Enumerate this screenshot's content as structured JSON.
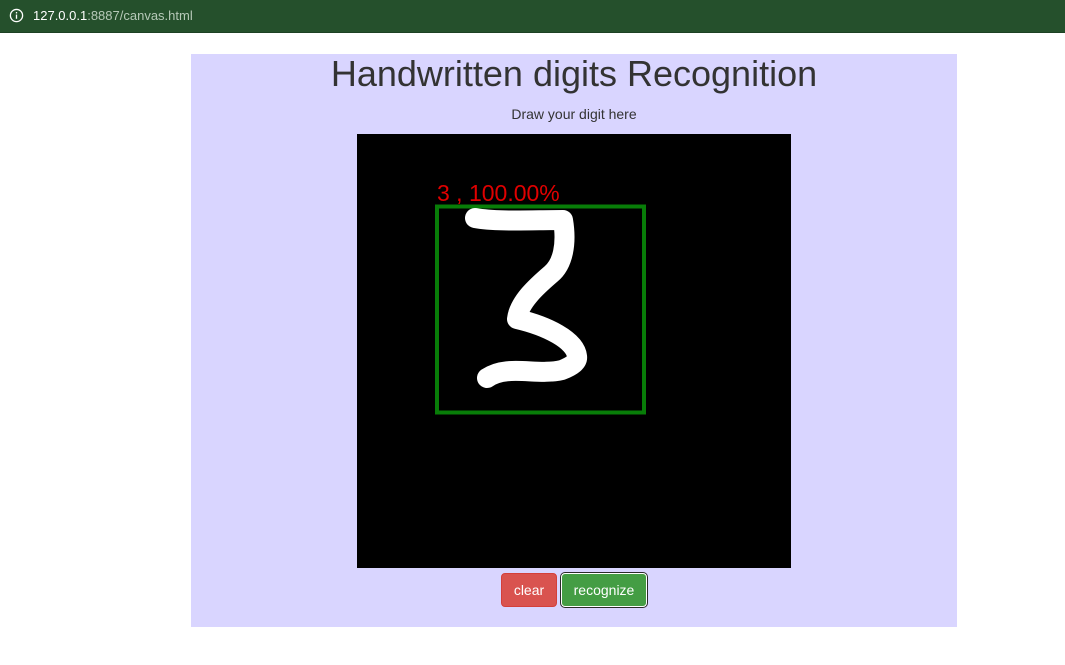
{
  "browser": {
    "url_host": "127.0.0.1",
    "url_rest": ":8887/canvas.html"
  },
  "page": {
    "title": "Handwritten digits Recognition",
    "subtitle": "Draw your digit here"
  },
  "canvas": {
    "prediction_label": "3 , 100.00%",
    "predicted_digit": "3",
    "confidence": "100.00%",
    "box_color": "#087d08",
    "label_color": "#e00000",
    "stroke_color": "#ffffff",
    "background_color": "#000000"
  },
  "buttons": {
    "clear_label": "clear",
    "recognize_label": "recognize",
    "clear_color": "#d9534f",
    "recognize_color": "#449d44"
  },
  "colors": {
    "panel_background": "#d9d5ff",
    "browser_bar": "#25502c"
  }
}
